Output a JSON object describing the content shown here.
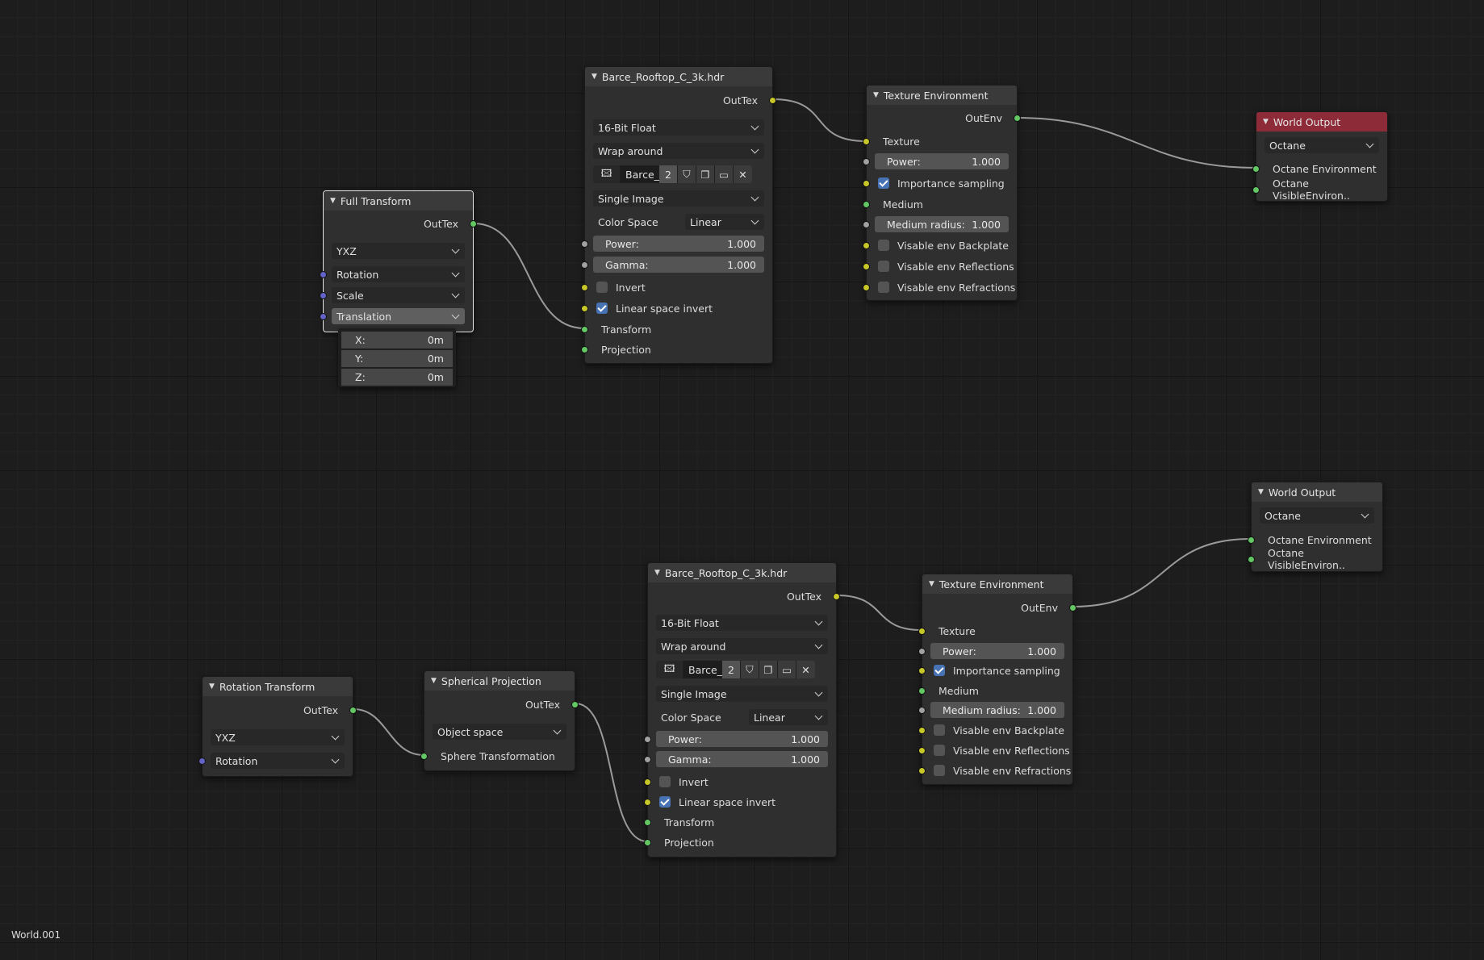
{
  "footer": {
    "world_name": "World.001"
  },
  "nodes": {
    "full_transform": {
      "title": "Full Transform",
      "out": "OutTex",
      "order": "YXZ",
      "rotation": "Rotation",
      "scale": "Scale",
      "translation": "Translation",
      "popup": {
        "x_label": "X:",
        "x": "0m",
        "y_label": "Y:",
        "y": "0m",
        "z_label": "Z:",
        "z": "0m"
      }
    },
    "image1": {
      "title": "Barce_Rooftop_C_3k.hdr",
      "out": "OutTex",
      "bit_depth": "16-Bit Float",
      "wrap": "Wrap around",
      "image_name": "Barce_",
      "users": "2",
      "source": "Single Image",
      "color_space_label": "Color Space",
      "color_space": "Linear",
      "power_label": "Power:",
      "power": "1.000",
      "gamma_label": "Gamma:",
      "gamma": "1.000",
      "invert": "Invert",
      "linear_invert": "Linear space invert",
      "transform": "Transform",
      "projection": "Projection"
    },
    "texenv1": {
      "title": "Texture Environment",
      "out": "OutEnv",
      "texture": "Texture",
      "power_label": "Power:",
      "power": "1.000",
      "importance": "Importance sampling",
      "medium": "Medium",
      "radius_label": "Medium radius:",
      "radius": "1.000",
      "backplate": "Visable env Backplate",
      "reflections": "Visable env Reflections",
      "refractions": "Visable env Refractions"
    },
    "world1": {
      "title": "World Output",
      "target": "Octane",
      "env": "Octane Environment",
      "visible": "Octane VisibleEnviron.."
    },
    "rot_transform": {
      "title": "Rotation Transform",
      "out": "OutTex",
      "order": "YXZ",
      "rotation": "Rotation"
    },
    "spherical": {
      "title": "Spherical Projection",
      "out": "OutTex",
      "space": "Object space",
      "sphere": "Sphere Transformation"
    },
    "image2": {
      "title": "Barce_Rooftop_C_3k.hdr",
      "out": "OutTex",
      "bit_depth": "16-Bit Float",
      "wrap": "Wrap around",
      "image_name": "Barce_",
      "users": "2",
      "source": "Single Image",
      "color_space_label": "Color Space",
      "color_space": "Linear",
      "power_label": "Power:",
      "power": "1.000",
      "gamma_label": "Gamma:",
      "gamma": "1.000",
      "invert": "Invert",
      "linear_invert": "Linear space invert",
      "transform": "Transform",
      "projection": "Projection"
    },
    "texenv2": {
      "title": "Texture Environment",
      "out": "OutEnv",
      "texture": "Texture",
      "power_label": "Power:",
      "power": "1.000",
      "importance": "Importance sampling",
      "medium": "Medium",
      "radius_label": "Medium radius:",
      "radius": "1.000",
      "backplate": "Visable env Backplate",
      "reflections": "Visable env Reflections",
      "refractions": "Visable env Refractions"
    },
    "world2": {
      "title": "World Output",
      "target": "Octane",
      "env": "Octane Environment",
      "visible": "Octane VisibleEnviron.."
    }
  },
  "colors": {
    "socket_color": "#63c763",
    "socket_float": "#a1a1a1",
    "socket_bool": "#c7c729",
    "socket_vector": "#6363c7",
    "wire": "#9a9a9a",
    "world_header": "#8e2b38",
    "checkbox_on": "#4772b3"
  },
  "icons": [
    "collapse-triangle-icon",
    "image-icon",
    "shield-icon",
    "duplicate-icon",
    "folder-icon",
    "close-icon",
    "chevron-down-icon"
  ]
}
